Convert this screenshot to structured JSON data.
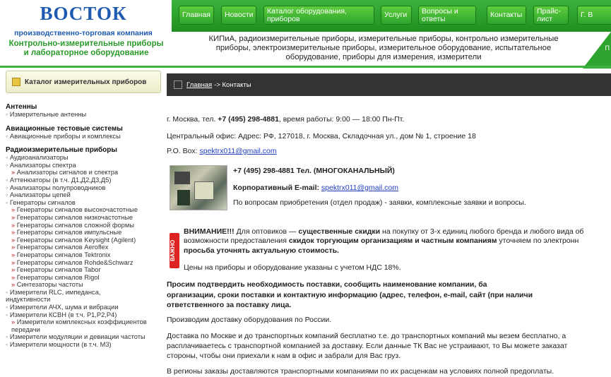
{
  "logo": {
    "title": "ВОСТОК",
    "subtitle": "производственно-торговая компания",
    "line1": "Контрольно-измерительные приборы",
    "line2": "и лабораторное оборудование"
  },
  "nav": [
    {
      "label": "Главная"
    },
    {
      "label": "Новости"
    },
    {
      "label": "Каталог оборудования, приборов"
    },
    {
      "label": "Услуги"
    },
    {
      "label": "Вопросы и ответы"
    },
    {
      "label": "Контакты"
    },
    {
      "label": "Прайс-лист"
    },
    {
      "label": "Г. В"
    }
  ],
  "tagline": [
    "КИПиА, радиоизмерительные приборы, измерительные приборы, контрольно измерительные",
    "приборы, электроизмерительные приборы, измерительное оборудование, испытательное",
    "оборудование, приборы для измерения, измерители"
  ],
  "badge": "П",
  "sidebar": {
    "catalog_title": "Каталог измерительных приборов",
    "s1": "Антенны",
    "s1i": "Измерительные антенны",
    "s2": "Авиационные тестовые системы",
    "s2i": "Авиационные приборы и комплексы",
    "s3": "Радиоизмерительные приборы",
    "items": [
      {
        "t": "Аудиоанализаторы",
        "k": "top"
      },
      {
        "t": "Анализаторы спектра",
        "k": "top"
      },
      {
        "t": "Анализаторы сигналов и спектра",
        "k": "sub"
      },
      {
        "t": "Аттенюаторы (в т.ч. Д1,Д2,Д3,Д5)",
        "k": "top"
      },
      {
        "t": "Анализаторы полупроводников",
        "k": "top"
      },
      {
        "t": "Анализаторы цепей",
        "k": "top"
      },
      {
        "t": "Генераторы сигналов",
        "k": "top"
      },
      {
        "t": "Генераторы сигналов высокочастотные",
        "k": "sub"
      },
      {
        "t": "Генераторы сигналов низкочастотные",
        "k": "sub"
      },
      {
        "t": "Генераторы сигналов сложной формы",
        "k": "sub"
      },
      {
        "t": "Генераторы сигналов импульсные",
        "k": "sub"
      },
      {
        "t": "Генераторы сигналов Keysight (Agilent)",
        "k": "sub"
      },
      {
        "t": "Генераторы сигналов Aeroflex",
        "k": "sub"
      },
      {
        "t": "Генераторы сигналов Tektronix",
        "k": "sub"
      },
      {
        "t": "Генераторы сигналов Rohde&Schwarz",
        "k": "sub"
      },
      {
        "t": "Генераторы сигналов Tabor",
        "k": "sub"
      },
      {
        "t": "Генераторы сигналов Rigol",
        "k": "sub"
      },
      {
        "t": "Синтезаторы частоты",
        "k": "sub"
      },
      {
        "t": "Измерители RLC, импеданса,",
        "k": "top"
      },
      {
        "t": "индуктивности",
        "k": "plain"
      },
      {
        "t": "Измерители АЧХ, шума и вибрации",
        "k": "top"
      },
      {
        "t": "Измерители КСВН (в т.ч. Р1,Р2,Р4)",
        "k": "top"
      },
      {
        "t": "Измерители комплексных коэффициентов",
        "k": "sub"
      },
      {
        "t": "передачи",
        "k": "plain2"
      },
      {
        "t": "Измерители модуляции и девиации частоты",
        "k": "top"
      },
      {
        "t": "Измерители мощности (в т.ч. М3)",
        "k": "top"
      }
    ]
  },
  "breadcrumb": {
    "home": "Главная",
    "rest": "-> Контакты"
  },
  "content": {
    "l1a": "г. Москва, тел. ",
    "l1b": "+7 (495) 298-4881",
    "l1c": ", время работы: 9:00 — 18:00 Пн-Пт.",
    "l2": "Центральный офис: Адрес: РФ, 127018, г. Москва, Складочная ул., дом № 1, строение 18",
    "l3a": "P.O. Box: ",
    "email": "spektrx011@gmail.com",
    "c1": "+7 (495) 298-4881  Тел. (МНОГОКАНАЛЬНЫЙ)",
    "c2": "Корпоративный  E-mail: ",
    "c3": "По вопросам приобретения (отдел продаж) - заявки, комплексные заявки и вопросы.",
    "warn_tag": "ВАЖНО",
    "w1a": "ВНИМАНИЕ!!!",
    "w1b": " Для оптовиков — ",
    "w1c": "существенные скидки",
    "w1d": " на покупку от 3-х единиц любого бренда и любого вида об",
    "w2a": "возможности предоставления ",
    "w2b": "скидок торгующим организациям и частным компаниям",
    "w2c": " уточняем по электронн",
    "w3": "просьба уточнять актуальную стоимость.",
    "w4": "Цены на приборы и оборудование указаны с учетом НДС 18%.",
    "r1": "Просим     подтвердить     необходимость     поставки,     сообщить     наименование     компании,     ба",
    "r2": "организации,  сроки  поставки  и  контактную  информацию  (адрес,  телефон,  e-mail,  сайт  (при  наличи",
    "r3": "ответственного за поставку лица.",
    "d1": "Производим доставку оборудования по России.",
    "d2": "Доставка по Москве и до транспортных компаний бесплатно т.е. до транспортных компаний мы везем бесплатно, а",
    "d3": "расплачиваетесь с транспортной компанией за доставку. Если данные ТК Вас не устраивают, то Вы можете заказат",
    "d4": "стороны, чтобы они приехали к нам в офис и забрали для Вас груз.",
    "d5": "В регионы заказы доставляются транспортными компаниями по их расценкам на условиях полной предоплаты."
  }
}
